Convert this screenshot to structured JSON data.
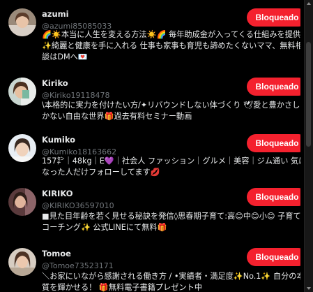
{
  "users": [
    {
      "name": "azumi",
      "handle": "@azumi85085033",
      "button_label": "Bloqueado",
      "bio": "🌈☀️本当に人生を変える方法☀️🌈 毎年助成金が入ってくる仕組みを提供✨綺麗と健康を手に入れる 仕事も家事も育児も諦めたくないママ、無料相談はDMへ💌"
    },
    {
      "name": "Kiriko",
      "handle": "@Kiriko19118478",
      "button_label": "Bloqueado",
      "bio": "\\本格的に実力を付けたい方/✦リバウンドしない体づくり 🕊愛と豊かさしかない自由な世界🎁過去有料セミナー動画"
    },
    {
      "name": "Kumiko",
      "handle": "@Kumiko18163662",
      "button_label": "Bloqueado",
      "bio": "157㌢｜48kg｜E💜｜社会人 ファッション｜グルメ｜美容｜ジム通い 気になった人だけフォローしてます💋"
    },
    {
      "name": "KIRIKO",
      "handle": "@KIRIKO36597010",
      "button_label": "Bloqueado",
      "bio": "■見た目年齢を若く見せる秘訣を発信◊思春期子育て:高😊中😊小😊 子育てコーチング✨ 公式LINEにて無料🎁"
    },
    {
      "name": "Tomoe",
      "handle": "@Tomoe73523171",
      "button_label": "Bloqueado",
      "bio": "＼お家にいながら感謝される働き方 / •実績者・満足度✨No.1✨ 自分の本質を輝かせる！ 🎁無料電子書籍プレゼント中"
    }
  ]
}
